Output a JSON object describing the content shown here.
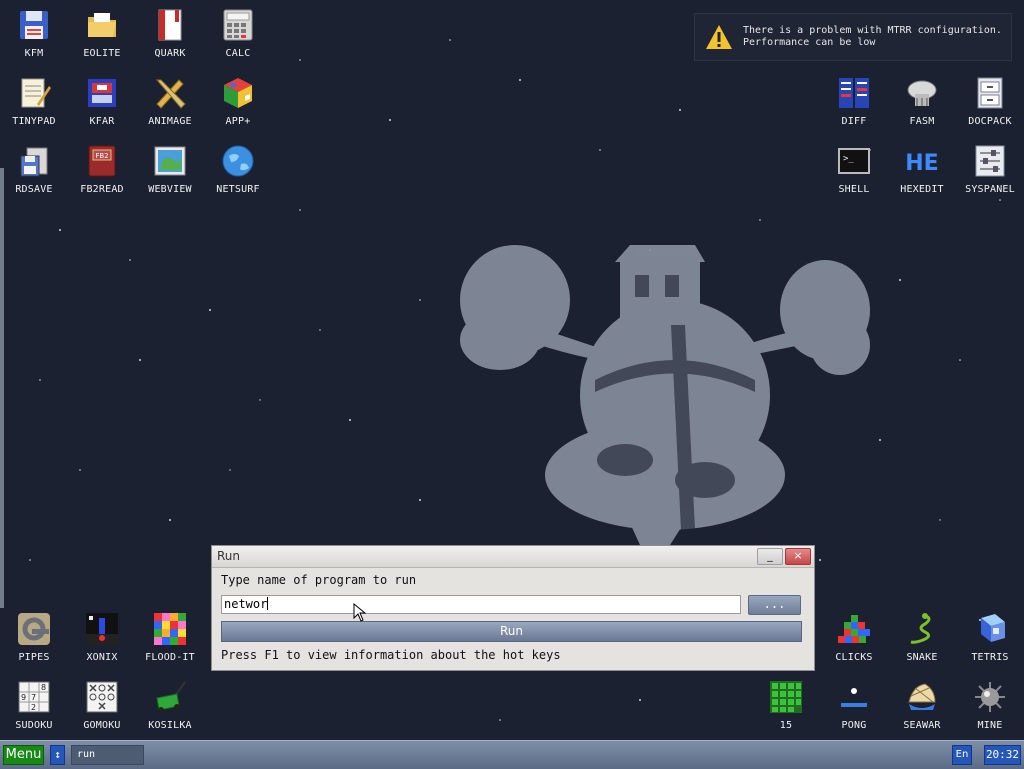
{
  "desktop_icons": {
    "kfm": {
      "label": "KFM",
      "icon": "floppy-icon"
    },
    "eolite": {
      "label": "EOLITE",
      "icon": "folder-icon"
    },
    "quark": {
      "label": "QUARK",
      "icon": "notebook-icon"
    },
    "calc": {
      "label": "CALC",
      "icon": "calculator-icon"
    },
    "tinypad": {
      "label": "TINYPAD",
      "icon": "notepad-icon"
    },
    "kfar": {
      "label": "KFAR",
      "icon": "archive-icon"
    },
    "animage": {
      "label": "ANIMAGE",
      "icon": "pencil-ruler-icon"
    },
    "appplus": {
      "label": "APP+",
      "icon": "cube-icon"
    },
    "rdsave": {
      "label": "RDSAVE",
      "icon": "save-disk-icon"
    },
    "fb2read": {
      "label": "FB2READ",
      "icon": "book-icon"
    },
    "webview": {
      "label": "WEBVIEW",
      "icon": "map-browser-icon"
    },
    "netsurf": {
      "label": "NETSURF",
      "icon": "globe-icon"
    },
    "diff": {
      "label": "DIFF",
      "icon": "compare-icon"
    },
    "fasm": {
      "label": "FASM",
      "icon": "assembler-icon"
    },
    "docpack": {
      "label": "DOCPACK",
      "icon": "cabinet-icon"
    },
    "shell": {
      "label": "SHELL",
      "icon": "terminal-icon"
    },
    "hexedit": {
      "label": "HEXEDIT",
      "icon": "hex-icon"
    },
    "syspanel": {
      "label": "SYSPANEL",
      "icon": "sliders-icon"
    },
    "pipes": {
      "label": "PIPES",
      "icon": "pipes-icon"
    },
    "xonix": {
      "label": "XONIX",
      "icon": "xonix-icon"
    },
    "floodit": {
      "label": "FLOOD-IT",
      "icon": "color-grid-icon"
    },
    "sudoku": {
      "label": "SUDOKU",
      "icon": "sudoku-icon"
    },
    "gomoku": {
      "label": "GOMOKU",
      "icon": "gomoku-icon"
    },
    "kosilka": {
      "label": "KOSILKA",
      "icon": "lawnmower-icon"
    },
    "clicks": {
      "label": "CLICKS",
      "icon": "blocks-icon"
    },
    "snake": {
      "label": "SNAKE",
      "icon": "snake-icon"
    },
    "tetris": {
      "label": "TETRIS",
      "icon": "tetris-icon"
    },
    "fifteen": {
      "label": "15",
      "icon": "fifteen-puzzle-icon"
    },
    "pong": {
      "label": "PONG",
      "icon": "pong-icon"
    },
    "seawar": {
      "label": "SEAWAR",
      "icon": "seawar-icon"
    },
    "mine": {
      "label": "MINE",
      "icon": "mine-icon"
    }
  },
  "notification": {
    "icon": "warning-icon",
    "line1": "There is a problem with MTRR configuration.",
    "line2": "Performance can be low"
  },
  "run_dialog": {
    "title": "Run",
    "minimize_label": "_",
    "close_label": "×",
    "prompt": "Type name of program to run",
    "input_value": "networ",
    "browse_label": "...",
    "run_label": "Run",
    "hint": "Press F1 to view information about the hot keys"
  },
  "taskbar": {
    "menu_label": "Menu",
    "swap_label": "↕",
    "task_label": "run",
    "lang": "En",
    "clock": "20:32"
  },
  "colors": {
    "background": "#1b2130",
    "menu_button": "#178a16",
    "taskbar": "#6a7a94",
    "accent_blue": "#2457b8"
  }
}
